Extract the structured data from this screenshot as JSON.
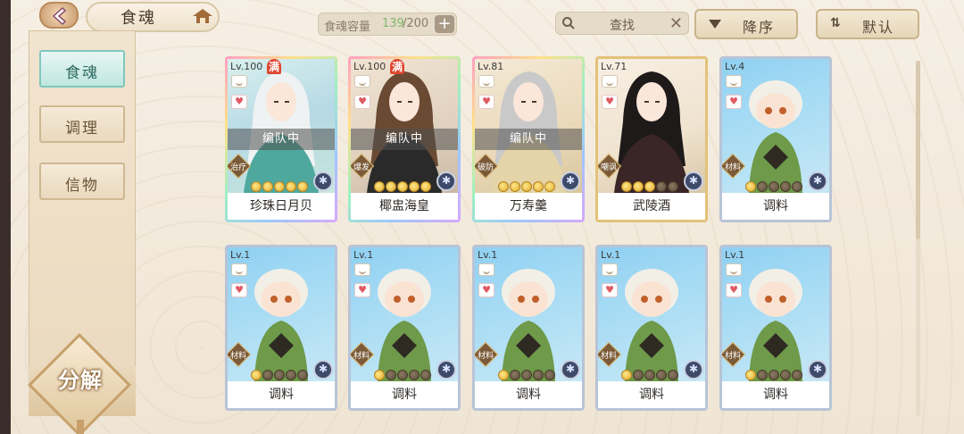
{
  "header": {
    "title": "食魂",
    "capacity": {
      "label": "食魂容量",
      "current": "139",
      "max": "/200",
      "plus": "+"
    },
    "search": {
      "placeholder": "查找",
      "clear": "✕"
    },
    "sort_order_label": "降序",
    "sort_mode_label": "默认"
  },
  "sidebar": {
    "items": [
      {
        "label": "食魂",
        "active": true
      },
      {
        "label": "调理",
        "active": false
      },
      {
        "label": "信物",
        "active": false
      }
    ],
    "decompose_label": "分解"
  },
  "cards": [
    {
      "level": "Lv.100",
      "full": "满",
      "in_team": "编队中",
      "role": "治疗",
      "stars_on": 5,
      "stars_total": 5,
      "name": "珍珠日月贝"
    },
    {
      "level": "Lv.100",
      "full": "满",
      "in_team": "编队中",
      "role": "爆发",
      "stars_on": 5,
      "stars_total": 5,
      "name": "椰盅海皇"
    },
    {
      "level": "Lv.81",
      "full": "",
      "in_team": "编队中",
      "role": "破防",
      "stars_on": 5,
      "stars_total": 5,
      "name": "万寿羹"
    },
    {
      "level": "Lv.71",
      "full": "",
      "in_team": "",
      "role": "嘲讽",
      "stars_on": 3,
      "stars_total": 5,
      "name": "武陵酒"
    },
    {
      "level": "Lv.4",
      "full": "",
      "in_team": "",
      "role": "材料",
      "stars_on": 1,
      "stars_total": 5,
      "name": "调料"
    },
    {
      "level": "Lv.1",
      "full": "",
      "in_team": "",
      "role": "材料",
      "stars_on": 1,
      "stars_total": 5,
      "name": "调料"
    },
    {
      "level": "Lv.1",
      "full": "",
      "in_team": "",
      "role": "材料",
      "stars_on": 1,
      "stars_total": 5,
      "name": "调料"
    },
    {
      "level": "Lv.1",
      "full": "",
      "in_team": "",
      "role": "材料",
      "stars_on": 1,
      "stars_total": 5,
      "name": "调料"
    },
    {
      "level": "Lv.1",
      "full": "",
      "in_team": "",
      "role": "材料",
      "stars_on": 1,
      "stars_total": 5,
      "name": "调料"
    },
    {
      "level": "Lv.1",
      "full": "",
      "in_team": "",
      "role": "材料",
      "stars_on": 1,
      "stars_total": 5,
      "name": "调料"
    }
  ],
  "icons": {
    "back": "back-icon",
    "home": "home-icon",
    "search": "search-icon",
    "sort": "sort-icon",
    "heart": "heart-icon",
    "bowl": "bowl-icon",
    "element": "element-icon"
  },
  "colors": {
    "capacity_current": "#7fb86a",
    "active_tab": "#bfe6e0",
    "full_badge": "#e0452e"
  }
}
